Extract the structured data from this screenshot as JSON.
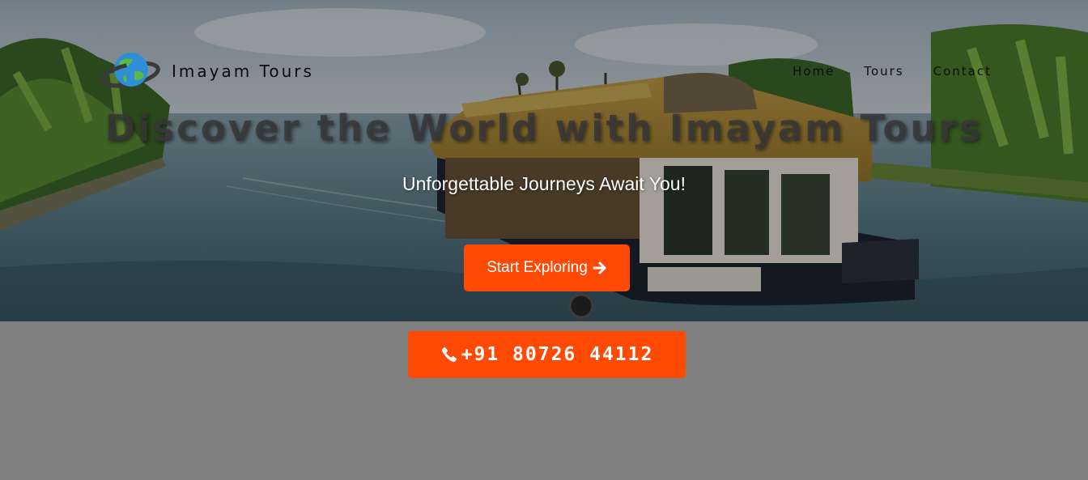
{
  "navbar": {
    "brand_name": "Imayam Tours",
    "logo_icon": "globe-icon",
    "links": [
      {
        "label": "Home"
      },
      {
        "label": "Tours"
      },
      {
        "label": "Contact"
      }
    ]
  },
  "hero": {
    "title": "Discover the World with Imayam Tours",
    "subtitle": "Unforgettable Journeys Await You!",
    "cta_label": "Start Exploring",
    "cta_icon": "arrow-right-icon",
    "background_scene": "houseboat-on-backwaters-image"
  },
  "contact_bar": {
    "phone": "+91 80726 44112",
    "phone_icon": "phone-icon"
  },
  "colors": {
    "accent": "#ff4a05",
    "page_background": "#808080",
    "text_light": "#ffffff",
    "text_dark": "#0d0d0d"
  }
}
